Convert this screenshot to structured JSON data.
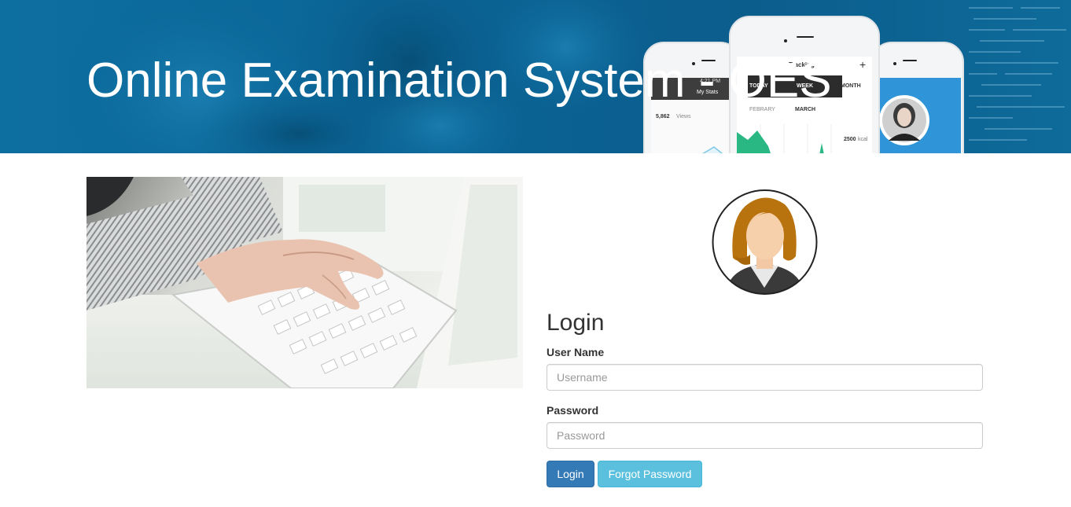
{
  "banner": {
    "title": "Online Examination System - OES",
    "phone_left": {
      "time": "4:21 PM",
      "screen_title": "My Stats",
      "stat": "5,862",
      "stat_unit": "Views"
    },
    "phone_center": {
      "screen_title": "Tracking",
      "tabs": [
        "TODAY",
        "WEEK",
        "MONTH"
      ],
      "months": [
        "FEBRARY",
        "MARCH"
      ],
      "stat": "2500",
      "stat_unit": "kcal"
    }
  },
  "login": {
    "heading": "Login",
    "username": {
      "label": "User Name",
      "placeholder": "Username",
      "value": ""
    },
    "password": {
      "label": "Password",
      "placeholder": "Password",
      "value": ""
    },
    "login_button": "Login",
    "forgot_button": "Forgot Password"
  },
  "colors": {
    "banner_blue": "#0b6596",
    "primary": "#337ab7",
    "info": "#5bc0de",
    "avatar_hair": "#b8730e"
  },
  "icons": {
    "avatar": "female-user-avatar-icon",
    "hero": "typing-on-laptop-illustration"
  }
}
